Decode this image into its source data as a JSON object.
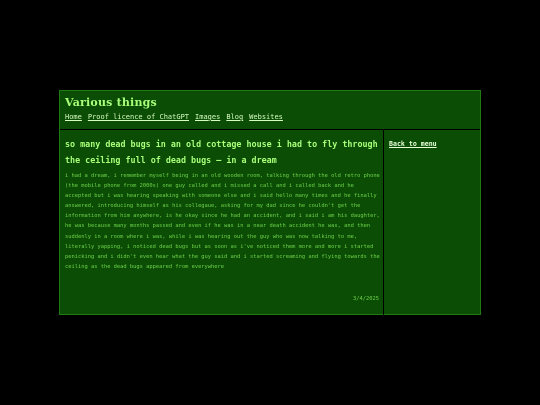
{
  "site": {
    "title": "Various things"
  },
  "nav": {
    "items": [
      "Home",
      "Proof licence of ChatGPT",
      "Images",
      "Blog",
      "Websites"
    ]
  },
  "post": {
    "title": "so many dead bugs in an old cottage house i had to fly through the ceiling full of dead bugs — in a dream",
    "body": "i had a dream, i remember myself being in an old wooden room, talking through the old retro phone (the mobile phone from 2000s) one guy called and i missed a call and i called back and he accepted but i was hearing speaking with someone else and i said hello many times and he finally answered, introducing himself as his collegaue, asking for my dad since he couldn't get the information from him anywhere, is he okay since he had an accident, and i said i am his daughter, he was because many months passed and even if he was in a near death accident he was, and then suddenly in a room where i was, while i was hearing out the guy who was now talking to me, literally yapping, i noticed dead bugs but as soon as i've noticed them more and more i started penicking and i didn't even hear what the guy said and i started screaming and flying towards the ceiling as the dead bugs appeared from everywhere",
    "date": "3/4/2025"
  },
  "sidebar": {
    "back_label": "Back to menu"
  },
  "colors": {
    "page_bg": "#000000",
    "panel_bg": "#0b4d05",
    "title_green": "#a8ff7a",
    "body_green": "#6fd44a",
    "link_light": "#d8ffc4"
  }
}
